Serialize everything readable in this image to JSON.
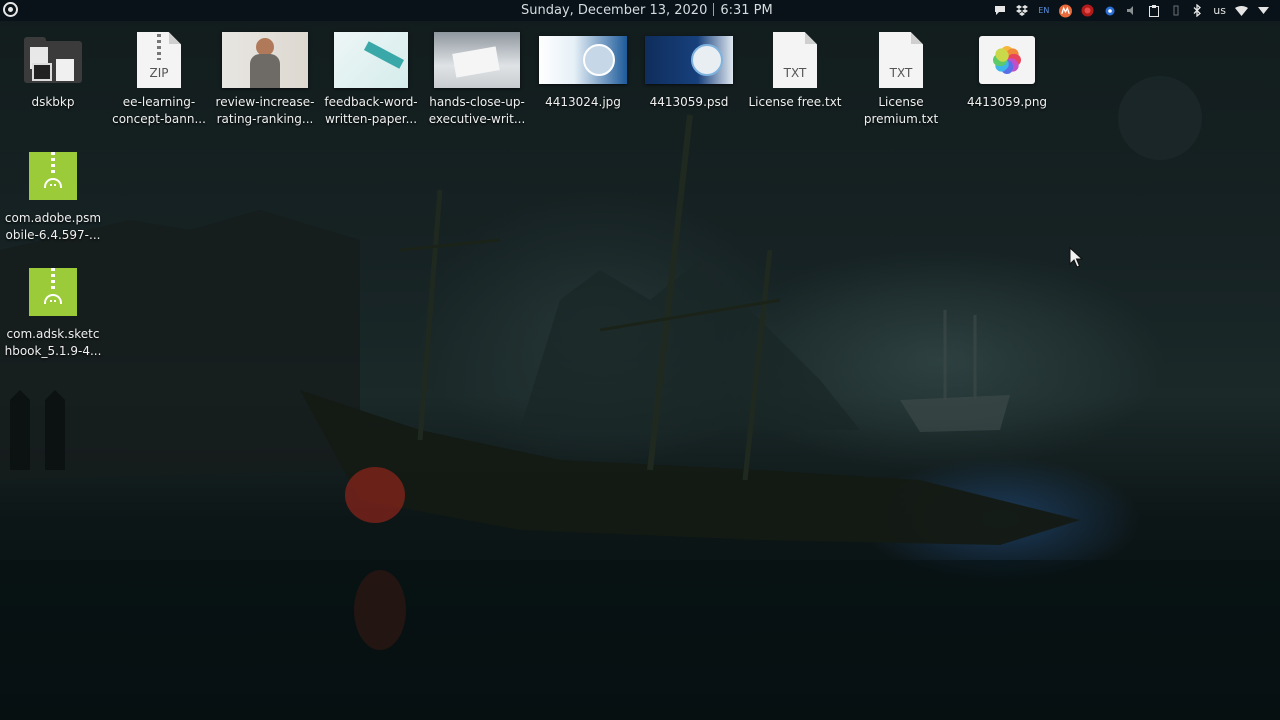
{
  "panel": {
    "date": "Sunday, December 13, 2020",
    "time": "6:31 PM",
    "tray": {
      "keyboard_indicator": "EN",
      "layout": "us"
    }
  },
  "desktop": {
    "icons": [
      {
        "id": "dskbkp",
        "label": "dskbkp",
        "type": "folder"
      },
      {
        "id": "ee-learning",
        "label": "ee-learning-\nconcept-bann...",
        "type": "zip",
        "ext": "ZIP"
      },
      {
        "id": "review-increase",
        "label": "review-increase-\nrating-ranking...",
        "type": "image"
      },
      {
        "id": "feedback-word",
        "label": "feedback-word-\nwritten-paper...",
        "type": "image"
      },
      {
        "id": "hands-close-up",
        "label": "hands-close-up-\nexecutive-writ...",
        "type": "image"
      },
      {
        "id": "4413024-jpg",
        "label": "4413024.jpg",
        "type": "image"
      },
      {
        "id": "4413059-psd",
        "label": "4413059.psd",
        "type": "image"
      },
      {
        "id": "license-free",
        "label": "License free.txt",
        "type": "text",
        "ext": "TXT"
      },
      {
        "id": "license-premium",
        "label": "License\npremium.txt",
        "type": "text",
        "ext": "TXT"
      },
      {
        "id": "4413059-png",
        "label": "4413059.png",
        "type": "png"
      },
      {
        "id": "psmobile-apk",
        "label": "com.adobe.psm\nobile-6.4.597-...",
        "type": "apk"
      },
      {
        "id": "sketchbook-apk",
        "label": "com.adsk.sketc\nhbook_5.1.9-4...",
        "type": "apk"
      }
    ]
  },
  "colors": {
    "panel_bg": "#081218",
    "apk_green": "#9ccb3a",
    "label_text": "#f0f0f0"
  }
}
